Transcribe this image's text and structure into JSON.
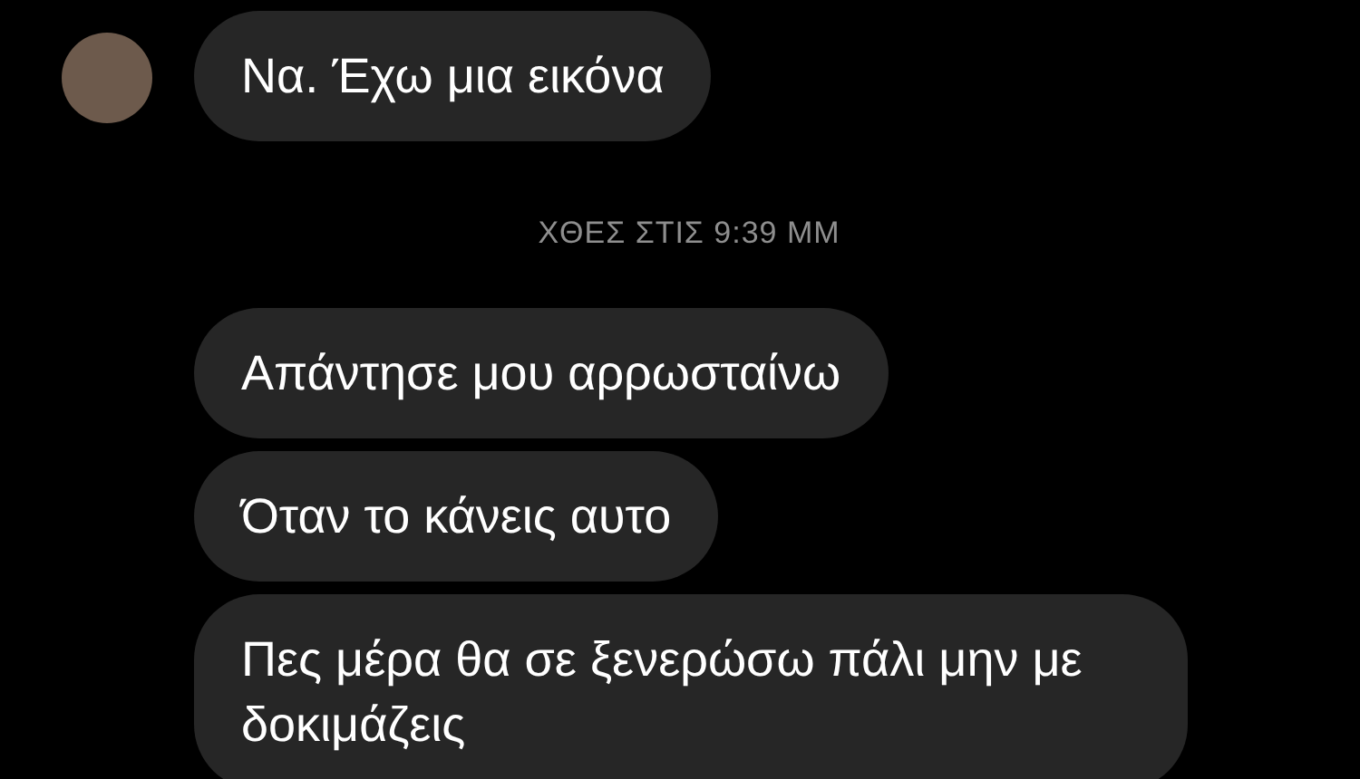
{
  "conversation": {
    "messages": [
      {
        "text": "Να. Έχω μια εικόνα",
        "show_avatar": true
      },
      {
        "kind": "timestamp",
        "text": "ΧΘΕΣ ΣΤΙΣ 9:39 ΜΜ"
      },
      {
        "text": "Απάντησε μου αρρωσταίνω",
        "show_avatar": false
      },
      {
        "text": "Όταν το κάνεις αυτο",
        "show_avatar": false
      },
      {
        "text": "Πες μέρα θα σε ξενερώσω πάλι μην με δοκιμάζεις",
        "show_avatar": false
      }
    ]
  }
}
